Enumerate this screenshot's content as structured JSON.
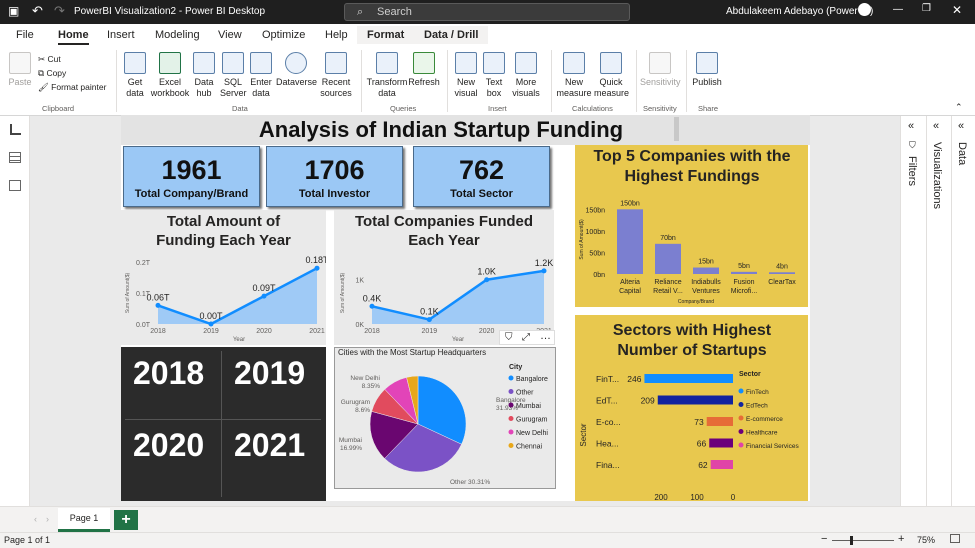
{
  "titlebar": {
    "title": "PowerBI Visualization2 - Power BI Desktop",
    "search": "Search",
    "user": "Abdulakeem Adebayo (Power BI)"
  },
  "menu": [
    "File",
    "Home",
    "Insert",
    "Modeling",
    "View",
    "Optimize",
    "Help",
    "Format",
    "Data / Drill"
  ],
  "ribbon": {
    "paste": "Paste",
    "cut": "Cut",
    "copy": "Copy",
    "format_painter": "Format painter",
    "clipboard": "Clipboard",
    "get_data": "Get data",
    "excel": "Excel workbook",
    "data_hub": "Data hub",
    "sql": "SQL Server",
    "enter": "Enter data",
    "dataverse": "Dataverse",
    "recent": "Recent sources",
    "data_grp": "Data",
    "transform": "Transform data",
    "refresh": "Refresh",
    "queries": "Queries",
    "new_visual": "New visual",
    "text_box": "Text box",
    "more_visuals": "More visuals",
    "insert": "Insert",
    "new_measure": "New measure",
    "quick_measure": "Quick measure",
    "calculations": "Calculations",
    "sensitivity": "Sensitivity",
    "sensitivity_grp": "Sensitivity",
    "publish": "Publish",
    "share": "Share"
  },
  "report": {
    "title": "Analysis of Indian Startup Funding",
    "cards": [
      {
        "value": "1961",
        "label": "Total Company/Brand"
      },
      {
        "value": "1706",
        "label": "Total Investor"
      },
      {
        "value": "762",
        "label": "Total Sector"
      }
    ],
    "years": [
      "2018",
      "2019",
      "2020",
      "2021"
    ],
    "cities_title": "Cities with the Most Startup Headquarters"
  },
  "panes": {
    "filters": "Filters",
    "visualizations": "Visualizations",
    "data": "Data"
  },
  "pages": {
    "page1": "Page 1",
    "add": "+"
  },
  "status": {
    "page": "Page 1 of 1",
    "zoom": "75%"
  },
  "chart_data": [
    {
      "type": "area",
      "title": "Total Amount of Funding Each Year",
      "xlabel": "Year",
      "ylabel": "Sum of Amount($)",
      "x": [
        "2018",
        "2019",
        "2020",
        "2021"
      ],
      "values": [
        0.06,
        0.0,
        0.09,
        0.18
      ],
      "data_labels": [
        "0.06T",
        "0.00T",
        "0.09T",
        "0.18T"
      ],
      "yticks": [
        "0.0T",
        "0.1T",
        "0.2T"
      ],
      "ylim": [
        0,
        0.2
      ]
    },
    {
      "type": "area",
      "title": "Total Companies Funded Each Year",
      "xlabel": "Year",
      "ylabel": "Sum of Amount($)",
      "x": [
        "2018",
        "2019",
        "2020",
        "2021"
      ],
      "values": [
        0.4,
        0.1,
        1.0,
        1.2
      ],
      "data_labels": [
        "0.4K",
        "0.1K",
        "1.0K",
        "1.2K"
      ],
      "yticks": [
        "0K",
        "1K"
      ],
      "ylim": [
        0,
        1.4
      ]
    },
    {
      "type": "bar",
      "title": "Top 5 Companies with the Highest Fundings",
      "xlabel": "Company/Brand",
      "ylabel": "Sum of Amount($)",
      "categories": [
        [
          "Alteria",
          "Capital"
        ],
        [
          "Reliance",
          "Retail V..."
        ],
        [
          "Indiabulls",
          "Ventures"
        ],
        [
          "Fusion",
          "Microfi..."
        ],
        [
          "ClearTax"
        ]
      ],
      "values": [
        150,
        70,
        15,
        5,
        4
      ],
      "data_labels": [
        "150bn",
        "70bn",
        "15bn",
        "5bn",
        "4bn"
      ],
      "yticks": [
        "0bn",
        "50bn",
        "100bn",
        "150bn"
      ],
      "ylim": [
        0,
        160
      ],
      "color": "#7b7fd0"
    },
    {
      "type": "pie",
      "title": "Cities with the Most Startup Headquarters",
      "legend_title": "City",
      "slices": [
        {
          "name": "Bangalore",
          "value": 31.93,
          "color": "#118dff"
        },
        {
          "name": "Other",
          "value": 30.31,
          "color": "#7b52c6"
        },
        {
          "name": "Mumbai",
          "value": 16.99,
          "color": "#6a0670"
        },
        {
          "name": "Gurugram",
          "value": 8.6,
          "color": "#e14b5e"
        },
        {
          "name": "New Delhi",
          "value": 8.35,
          "color": "#e244b8"
        },
        {
          "name": "Chennai",
          "value": 3.82,
          "color": "#e8a71a"
        }
      ],
      "labels": [
        "Bangalore 31.93%",
        "Other 30.31%",
        "Mumbai 16.99%",
        "Gurugram 8.6%",
        "New Delhi 8.35%"
      ]
    },
    {
      "type": "bar",
      "orientation": "horizontal",
      "title": "Sectors with Highest Number of Startups",
      "xlabel": "Number",
      "ylabel": "Sector",
      "legend_title": "Sector",
      "categories": [
        "FinT...",
        "EdT...",
        "E-co...",
        "Hea...",
        "Fina..."
      ],
      "legend": [
        "FinTech",
        "EdTech",
        "E-commerce",
        "Healthcare",
        "Financial Services"
      ],
      "values": [
        246,
        209,
        73,
        66,
        62
      ],
      "colors": [
        "#118dff",
        "#12239e",
        "#e66c37",
        "#6b007b",
        "#e044a7"
      ],
      "xticks": [
        "200",
        "100",
        "0"
      ],
      "xlim": [
        0,
        250
      ]
    }
  ]
}
